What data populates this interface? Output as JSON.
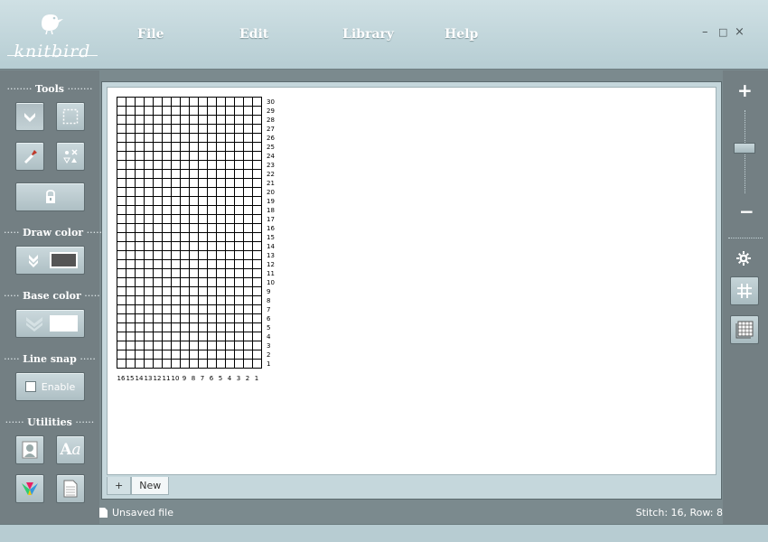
{
  "app": {
    "logo_text": "knitbird"
  },
  "menu": {
    "file": "File",
    "edit": "Edit",
    "library": "Library",
    "help": "Help"
  },
  "window": {
    "minimize": "–",
    "maximize": "□",
    "close": "×"
  },
  "sidebar": {
    "tools_title": "Tools",
    "draw_color_title": "Draw color",
    "base_color_title": "Base color",
    "line_snap_title": "Line snap",
    "line_snap_label": "Enable",
    "utilities_title": "Utilities",
    "draw_color_value": "#555555",
    "base_color_value": "#ffffff"
  },
  "right": {
    "zoom_in": "+",
    "zoom_out": "−"
  },
  "grid": {
    "stitch_labels": [
      "16",
      "15",
      "14",
      "13",
      "12",
      "11",
      "10",
      "9",
      "8",
      "7",
      "6",
      "5",
      "4",
      "3",
      "2",
      "1"
    ],
    "row_labels": [
      "30",
      "29",
      "28",
      "27",
      "26",
      "25",
      "24",
      "23",
      "22",
      "21",
      "20",
      "19",
      "18",
      "17",
      "16",
      "15",
      "14",
      "13",
      "12",
      "11",
      "10",
      "9",
      "8",
      "7",
      "6",
      "5",
      "4",
      "3",
      "2",
      "1"
    ]
  },
  "tabs": {
    "add": "+",
    "current": "New"
  },
  "status": {
    "file": "Unsaved file",
    "position": "Stitch: 16, Row: 8"
  }
}
